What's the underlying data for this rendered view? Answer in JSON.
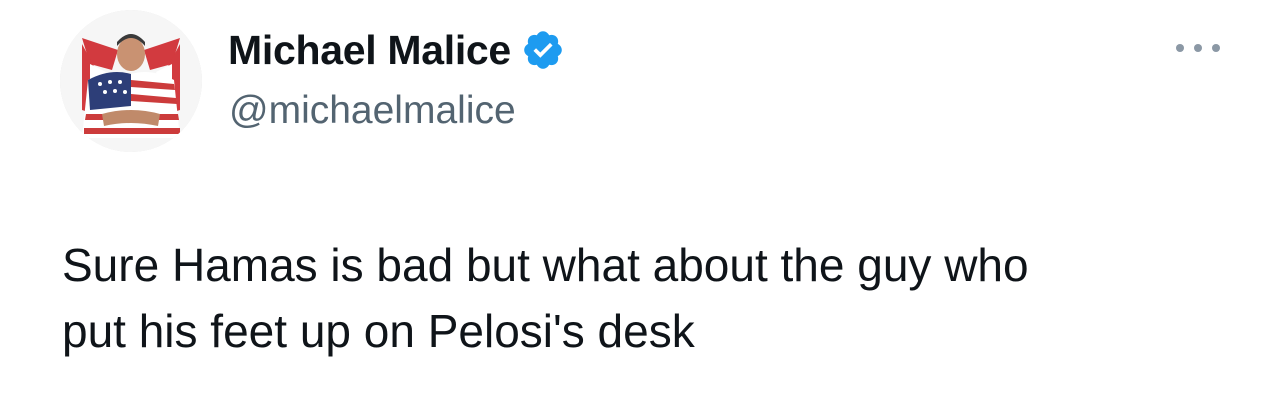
{
  "author": {
    "display_name": "Michael Malice",
    "handle": "@michaelmalice",
    "verified": true,
    "verified_color": "#1d9bf0"
  },
  "tweet": {
    "text_lines": [
      "Sure Hamas is bad but what about the guy who",
      "put his feet up on Pelosi's desk"
    ]
  },
  "icons": {
    "verified": "verified-badge-icon",
    "more": "more-horizontal-icon"
  },
  "colors": {
    "text_primary": "#0f1419",
    "text_secondary": "#536471",
    "icon_muted": "#8b98a5"
  }
}
